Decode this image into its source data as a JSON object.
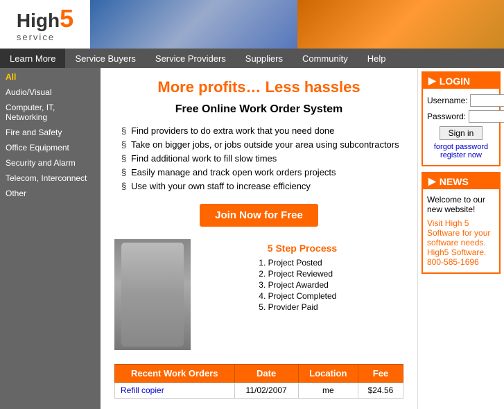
{
  "header": {
    "logo": {
      "high": "High",
      "five": "5",
      "service": "service"
    }
  },
  "nav": {
    "items": [
      {
        "id": "learn-more",
        "label": "Learn More"
      },
      {
        "id": "service-buyers",
        "label": "Service Buyers"
      },
      {
        "id": "service-providers",
        "label": "Service Providers"
      },
      {
        "id": "suppliers",
        "label": "Suppliers"
      },
      {
        "id": "community",
        "label": "Community"
      },
      {
        "id": "help",
        "label": "Help"
      }
    ]
  },
  "sidebar": {
    "items": [
      {
        "id": "all",
        "label": "All"
      },
      {
        "id": "audio-visual",
        "label": "Audio/Visual"
      },
      {
        "id": "computer-it",
        "label": "Computer, IT, Networking"
      },
      {
        "id": "fire-safety",
        "label": "Fire and Safety"
      },
      {
        "id": "office-equipment",
        "label": "Office Equipment"
      },
      {
        "id": "security-alarm",
        "label": "Security and Alarm"
      },
      {
        "id": "telecom",
        "label": "Telecom, Interconnect"
      },
      {
        "id": "other",
        "label": "Other"
      }
    ]
  },
  "main": {
    "headline": "More profits… Less hassles",
    "subheadline": "Free Online Work Order System",
    "bullets": [
      "Find providers to do extra work that you need done",
      "Take on bigger jobs, or jobs outside your area using subcontractors",
      "Find additional work to fill slow times",
      "Easily manage and track open work orders projects",
      "Use with your own staff to increase efficiency"
    ],
    "join_button": "Join Now for Free",
    "five_step": {
      "title": "5 Step Process",
      "steps": [
        "Project Posted",
        "Project Reviewed",
        "Project Awarded",
        "Project Completed",
        "Provider Paid"
      ]
    },
    "work_orders": {
      "title": "Recent Work Orders",
      "columns": [
        "Recent Work Orders",
        "Date",
        "Location",
        "Fee"
      ],
      "rows": [
        {
          "name": "Refill copier",
          "date": "11/02/2007",
          "location": "me",
          "fee": "$24.56"
        }
      ]
    }
  },
  "login": {
    "title": "LOGIN",
    "arrow": "▶",
    "username_label": "Username:",
    "password_label": "Password:",
    "signin_button": "Sign in",
    "forgot_password": "forgot password",
    "register_now": "register now"
  },
  "news": {
    "title": "NEWS",
    "arrow": "▶",
    "welcome_text": "Welcome to our new website!",
    "news_link_text": "Visit High 5 Software for your software needs. High5 Software. 800-585-1696"
  }
}
